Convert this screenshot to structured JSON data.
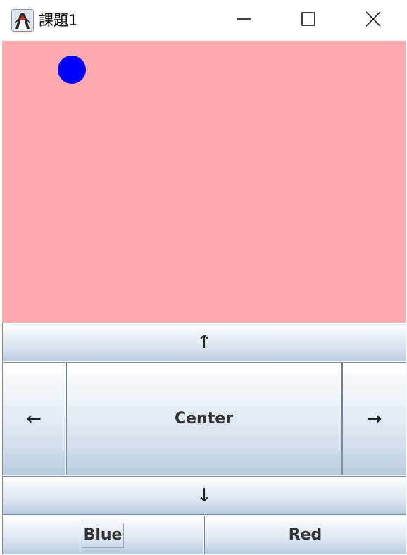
{
  "window": {
    "title": "課題1",
    "icon": "java-duke-icon",
    "controls": {
      "minimize_icon": "minimize-icon",
      "maximize_icon": "maximize-icon",
      "close_icon": "close-icon"
    }
  },
  "canvas": {
    "background_color": "#ffabad",
    "ball_color": "#0000ff"
  },
  "buttons": {
    "up": "↑",
    "left": "←",
    "center": "Center",
    "right": "→",
    "down": "↓",
    "blue": "Blue",
    "red": "Red"
  }
}
